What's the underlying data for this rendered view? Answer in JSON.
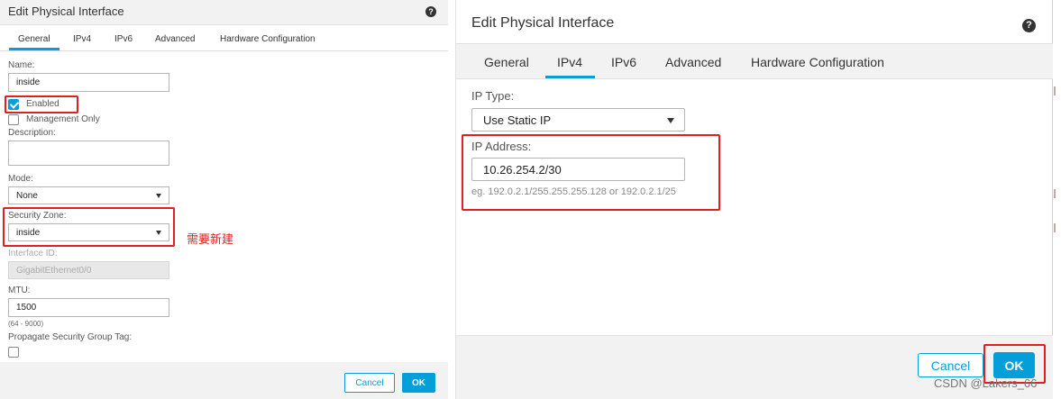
{
  "left_dialog": {
    "title": "Edit Physical Interface",
    "help_glyph": "?",
    "tabs": [
      {
        "label": "General",
        "active": true
      },
      {
        "label": "IPv4",
        "active": false
      },
      {
        "label": "IPv6",
        "active": false
      },
      {
        "label": "Advanced",
        "active": false
      },
      {
        "label": "Hardware Configuration",
        "active": false
      }
    ],
    "name_label": "Name:",
    "name_value": "inside",
    "enabled_label": "Enabled",
    "enabled_checked": true,
    "management_only_label": "Management Only",
    "management_only_checked": false,
    "description_label": "Description:",
    "description_value": "",
    "mode_label": "Mode:",
    "mode_value": "None",
    "security_zone_label": "Security Zone:",
    "security_zone_value": "inside",
    "interface_id_label": "Interface ID:",
    "interface_id_value": "GigabitEthernet0/0",
    "mtu_label": "MTU:",
    "mtu_value": "1500",
    "mtu_range": "(64 - 9000)",
    "propagate_label": "Propagate Security Group Tag:",
    "propagate_checked": false,
    "cancel_label": "Cancel",
    "ok_label": "OK"
  },
  "annotation_note": "需要新建",
  "right_dialog": {
    "title": "Edit Physical Interface",
    "help_glyph": "?",
    "tabs": [
      {
        "label": "General",
        "active": false
      },
      {
        "label": "IPv4",
        "active": true
      },
      {
        "label": "IPv6",
        "active": false
      },
      {
        "label": "Advanced",
        "active": false
      },
      {
        "label": "Hardware Configuration",
        "active": false
      }
    ],
    "ip_type_label": "IP Type:",
    "ip_type_value": "Use Static IP",
    "ip_address_label": "IP Address:",
    "ip_address_value": "10.26.254.2/30",
    "ip_address_hint": "eg. 192.0.2.1/255.255.255.128 or 192.0.2.1/25",
    "cancel_label": "Cancel",
    "ok_label": "OK"
  },
  "watermark": "CSDN @Lakers_66",
  "colors": {
    "accent": "#049fd9",
    "highlight_box": "#e02020",
    "title_bar": "#f2f2f2"
  }
}
